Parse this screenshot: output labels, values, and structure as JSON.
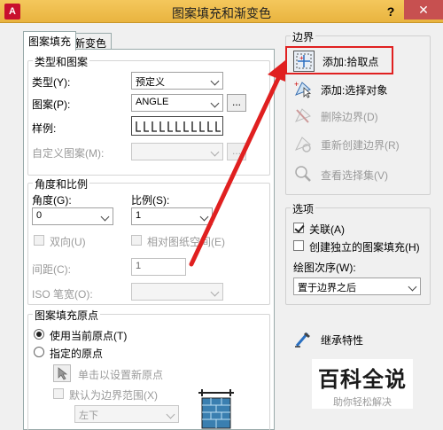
{
  "window": {
    "title": "图案填充和渐变色",
    "help": "?",
    "close": "✕"
  },
  "tabs": [
    {
      "label": "图案填充",
      "active": true
    },
    {
      "label": "新变色",
      "active": false
    }
  ],
  "type_pattern": {
    "legend": "类型和图案",
    "type_label": "类型(Y):",
    "type_value": "预定义",
    "pattern_label": "图案(P):",
    "pattern_value": "ANGLE",
    "pattern_more": "...",
    "sample_label": "样例:",
    "custom_label": "自定义图案(M):",
    "custom_more": "..."
  },
  "angle_scale": {
    "legend": "角度和比例",
    "angle_label": "角度(G):",
    "angle_value": "0",
    "scale_label": "比例(S):",
    "scale_value": "1",
    "double_label": "双向(U)",
    "relative_label": "相对图纸空间(E)",
    "spacing_label": "间距(C):",
    "spacing_value": "1",
    "iso_label": "ISO 笔宽(O):"
  },
  "origin": {
    "legend": "图案填充原点",
    "use_current_label": "使用当前原点(T)",
    "specified_label": "指定的原点",
    "click_set_label": "单击以设置新原点",
    "default_extents_label": "默认为边界范围(X)",
    "position_value": "左下"
  },
  "boundaries": {
    "legend": "边界",
    "pick_points": "添加:拾取点",
    "select_objects": "添加:选择对象",
    "remove": "删除边界(D)",
    "recreate": "重新创建边界(R)",
    "view_selections": "查看选择集(V)"
  },
  "options": {
    "legend": "选项",
    "associative": "关联(A)",
    "separate": "创建独立的图案填充(H)",
    "draw_order_label": "绘图次序(W):",
    "draw_order_value": "置于边界之后"
  },
  "inherit": {
    "label": "继承特性"
  },
  "watermark": {
    "title": "百科全说",
    "subtitle": "助你轻松解决"
  },
  "colors": {
    "accent_red": "#e02020",
    "titlebar": "#e9b43f"
  }
}
